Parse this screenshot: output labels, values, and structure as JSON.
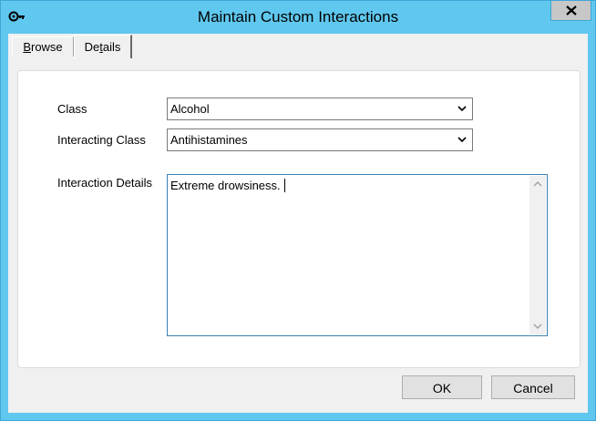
{
  "window": {
    "title": "Maintain Custom Interactions"
  },
  "tabs": [
    {
      "label_prefix": "",
      "label_underlined": "B",
      "label_rest": "rowse"
    },
    {
      "label_prefix": "De",
      "label_underlined": "t",
      "label_rest": "ails"
    }
  ],
  "form": {
    "class_label": "Class",
    "class_value": "Alcohol",
    "interacting_class_label": "Interacting Class",
    "interacting_class_value": "Antihistamines",
    "details_label": "Interaction Details",
    "details_value": "Extreme drowsiness."
  },
  "buttons": {
    "ok_label": "OK",
    "cancel_label": "Cancel"
  },
  "colors": {
    "titlebar": "#60c8ef",
    "focus_border": "#3c7fb1"
  }
}
